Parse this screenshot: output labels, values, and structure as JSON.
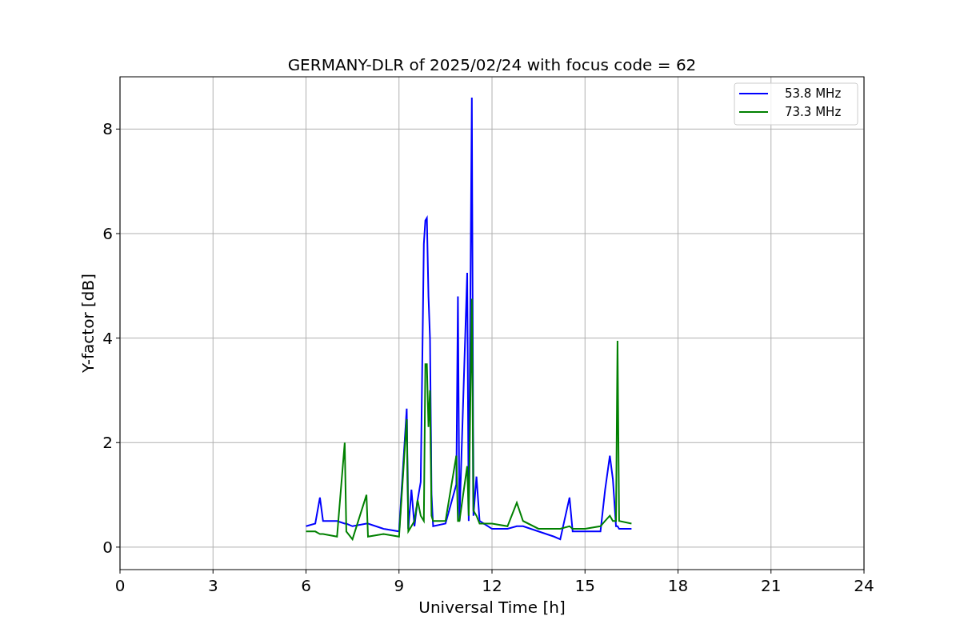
{
  "figure": {
    "chart_data": {
      "type": "line",
      "title": "GERMANY-DLR of 2025/02/24 with focus code = 62",
      "xlabel": "Universal Time [h]",
      "ylabel": "Y-factor [dB]",
      "xlim": [
        0,
        24
      ],
      "ylim": [
        -0.43,
        9.0
      ],
      "xticks": [
        0,
        3,
        6,
        9,
        12,
        15,
        18,
        21,
        24
      ],
      "yticks": [
        0,
        2,
        4,
        6,
        8
      ],
      "grid": true,
      "legend": true,
      "x": [
        6.0,
        6.3,
        6.45,
        6.55,
        7.0,
        7.25,
        7.3,
        7.5,
        7.95,
        8.0,
        8.5,
        9.0,
        9.25,
        9.3,
        9.4,
        9.5,
        9.6,
        9.7,
        9.8,
        9.85,
        9.9,
        9.95,
        10.0,
        10.05,
        10.1,
        10.5,
        10.85,
        10.9,
        10.95,
        11.2,
        11.25,
        11.35,
        11.4,
        11.5,
        11.6,
        12.0,
        12.5,
        12.8,
        13.0,
        13.5,
        14.0,
        14.2,
        14.5,
        14.6,
        15.0,
        15.5,
        15.65,
        15.8,
        15.9,
        16.0,
        16.05,
        16.1,
        16.5
      ],
      "series": [
        {
          "name": "53.8 MHz",
          "color": "#0000ff",
          "values": [
            0.4,
            0.45,
            0.95,
            0.5,
            0.5,
            0.45,
            0.45,
            0.4,
            0.45,
            0.45,
            0.35,
            0.3,
            2.65,
            0.35,
            1.1,
            0.4,
            0.9,
            1.25,
            5.8,
            6.25,
            6.3,
            4.8,
            4.0,
            1.0,
            0.4,
            0.45,
            1.2,
            4.8,
            0.5,
            5.25,
            0.5,
            8.6,
            0.6,
            1.35,
            0.5,
            0.35,
            0.35,
            0.4,
            0.4,
            0.3,
            0.2,
            0.15,
            0.95,
            0.3,
            0.3,
            0.3,
            1.1,
            1.75,
            1.3,
            0.4,
            0.4,
            0.35,
            0.35
          ]
        },
        {
          "name": "73.3 MHz",
          "color": "#008000",
          "values": [
            0.3,
            0.3,
            0.25,
            0.25,
            0.2,
            2.0,
            0.3,
            0.15,
            1.0,
            0.2,
            0.25,
            0.2,
            2.45,
            0.3,
            0.4,
            0.5,
            0.9,
            0.6,
            0.5,
            3.5,
            3.5,
            2.3,
            3.0,
            0.6,
            0.5,
            0.5,
            1.75,
            0.5,
            0.5,
            1.55,
            0.6,
            4.75,
            0.7,
            0.6,
            0.45,
            0.45,
            0.4,
            0.85,
            0.5,
            0.35,
            0.35,
            0.35,
            0.4,
            0.35,
            0.35,
            0.4,
            0.5,
            0.6,
            0.5,
            0.5,
            3.95,
            0.5,
            0.45
          ]
        }
      ]
    }
  }
}
